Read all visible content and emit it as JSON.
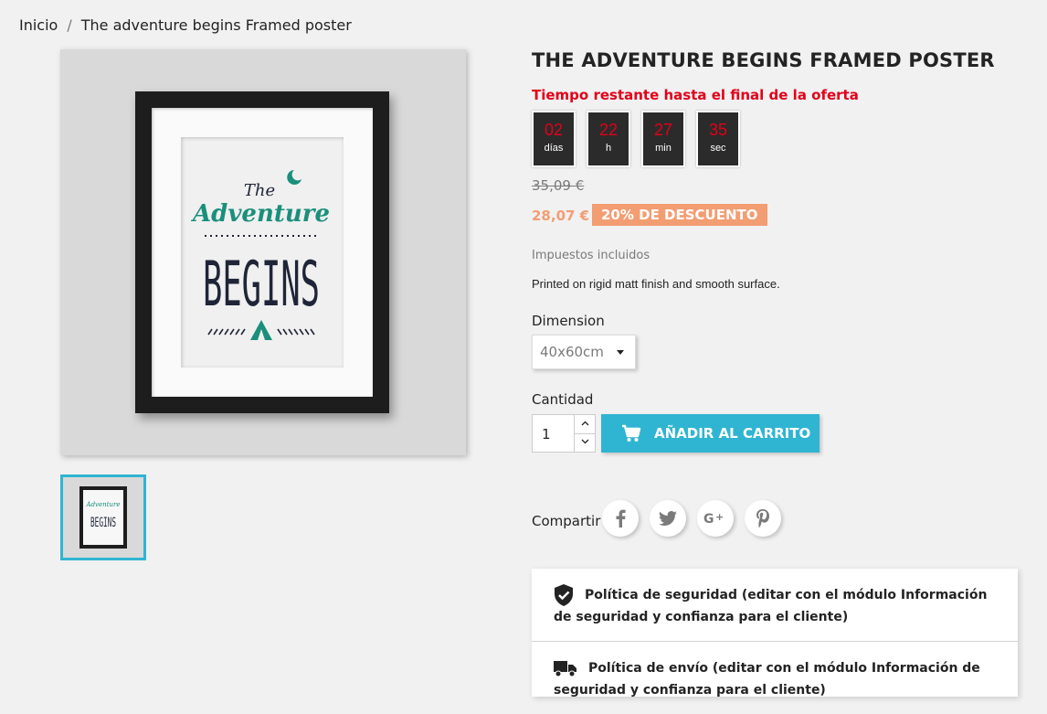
{
  "breadcrumb": {
    "home": "Inicio",
    "separator": "/",
    "current": "The adventure begins Framed poster"
  },
  "product": {
    "title": "THE ADVENTURE BEGINS FRAMED POSTER",
    "poster": {
      "line1": "The",
      "line2": "Adventure",
      "line3": "BEGINS"
    },
    "countdown": {
      "label": "Tiempo restante hasta el final de la oferta",
      "units": [
        {
          "value": "02",
          "unit": "días"
        },
        {
          "value": "22",
          "unit": "h"
        },
        {
          "value": "27",
          "unit": "min"
        },
        {
          "value": "35",
          "unit": "sec"
        }
      ]
    },
    "old_price": "35,09 €",
    "new_price": "28,07 €",
    "discount": "20% DE DESCUENTO",
    "taxes": "Impuestos incluidos",
    "description": "Printed on rigid matt finish and smooth surface.",
    "dimension": {
      "label": "Dimension",
      "selected": "40x60cm"
    },
    "quantity": {
      "label": "Cantidad",
      "value": "1"
    },
    "add_to_cart": "AÑADIR AL CARRITO",
    "share": {
      "label": "Compartir",
      "networks": [
        "facebook",
        "twitter",
        "google-plus",
        "pinterest"
      ]
    }
  },
  "reassurance": [
    {
      "icon": "shield-icon",
      "text": "Política de seguridad (editar con el módulo Información de seguridad y confianza para el cliente)"
    },
    {
      "icon": "truck-icon",
      "text": "Política de envío (editar con el módulo Información de seguridad y confianza para el cliente)"
    }
  ],
  "colors": {
    "accent": "#2fb5d2",
    "discount": "#f39d72",
    "countdown": "#e2001a",
    "teal": "#1a8f7c",
    "navy": "#1f2537"
  }
}
